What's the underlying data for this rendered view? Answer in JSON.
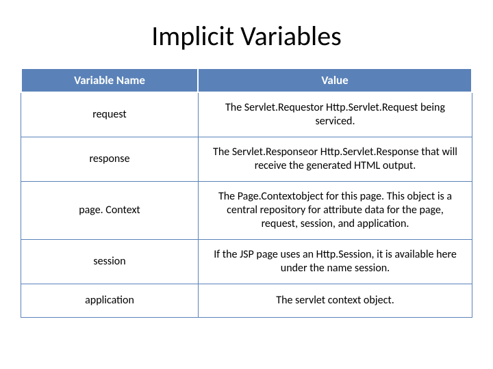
{
  "title": "Implicit Variables",
  "headers": {
    "col1": "Variable Name",
    "col2": "Value"
  },
  "rows": [
    {
      "name": "request",
      "value": "The Servlet.Requestor Http.Servlet.Request being serviced."
    },
    {
      "name": "response",
      "value": "The Servlet.Responseor Http.Servlet.Response that will receive the generated HTML output."
    },
    {
      "name": "page. Context",
      "value": "The Page.Contextobject for this page. This object is a central repository for attribute data for the page, request, session, and application."
    },
    {
      "name": "session",
      "value": "If the JSP page uses an Http.Session, it is available here under the name session."
    },
    {
      "name": "application",
      "value": "The servlet context object."
    }
  ]
}
